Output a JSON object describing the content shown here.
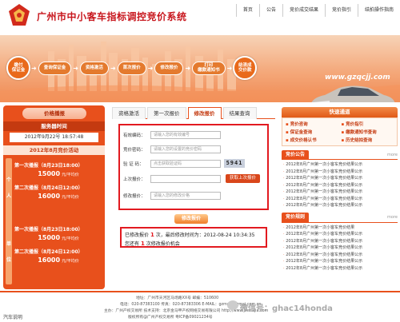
{
  "header": {
    "site_title": "广州市中小客车指标调控竞价系统",
    "nav": [
      "首页",
      "公告",
      "竞价成交结果",
      "竞价指引",
      "结拍操作指南"
    ]
  },
  "banner": {
    "website": "www.gzqcjj.com",
    "steps": [
      {
        "label": "缴付\n保证金",
        "shape": "circle"
      },
      {
        "label": "查询保证金",
        "shape": "pill"
      },
      {
        "label": "资格激活",
        "shape": "pill"
      },
      {
        "label": "首次报价",
        "shape": "pill"
      },
      {
        "label": "修改报价",
        "shape": "pill"
      },
      {
        "label": "打印\n缴款通知书",
        "shape": "pill"
      },
      {
        "label": "结清成\n交价款",
        "shape": "circle"
      }
    ]
  },
  "left": {
    "tab": "价格播报",
    "server_time_label": "服务器时间",
    "server_time": "2012年9月22号 18:57:48",
    "activity_title": "2012年8月竞价活动",
    "side_labels": [
      "个",
      "人",
      "单",
      "位"
    ],
    "rounds": [
      {
        "title": "第一次播报（8月23日18:00）",
        "price": "15000",
        "unit": "元/平均价"
      },
      {
        "title": "第二次播报（8月24日12:00）",
        "price": "16000",
        "unit": "元/平均价"
      },
      {
        "title": "第一次播报（8月23日18:00）",
        "price": "15000",
        "unit": "元/平均价"
      },
      {
        "title": "第二次播报（8月24日12:00）",
        "price": "16000",
        "unit": "元/平均价"
      }
    ]
  },
  "main": {
    "tabs": [
      "资格激活",
      "第一次报价",
      "修改报价",
      "结果查询"
    ],
    "active_tab": 2,
    "form": {
      "code_label": "有效编码：",
      "code_ph": "请输入您的有效编号",
      "pwd_label": "竞价密码：",
      "pwd_ph": "请输入您的设置的竞价密码",
      "captcha_label": "验 证 码：",
      "captcha_ph": "点击获取验证码",
      "captcha_value": "5941",
      "last_label": "上次报价：",
      "get_last": "获取上次报价",
      "modify_label": "修改报价：",
      "modify_ph": "请输入您的修改价格"
    },
    "submit": "修改报价",
    "result": {
      "line1_a": "已修改报价",
      "line1_b": "1",
      "line1_c": "次，最后修改时间为：2012-08-24 10:34:35",
      "line2_a": "您还有",
      "line2_b": "1",
      "line2_c": "次修改报价机会"
    }
  },
  "right": {
    "quick_title": "快速通道",
    "quick_links": [
      "竞价咨询",
      "竞价指引",
      "保证金查询",
      "缴款通知书查询",
      "成交价格认书",
      "历史结拍查询"
    ],
    "announce_title": "竞价公告",
    "announce_more": "more",
    "announce_items": [
      "2012年8月广州第一次小客车竞价结果公示",
      "2012年8月广州第一次小客车竞价结果公示",
      "2012年8月广州第一次小客车竞价结果公示",
      "2012年8月广州第一次小客车竞价结果公示",
      "2012年8月广州第一次小客车竞价结果公示",
      "2012年8月广州第一次小客车竞价结果公示",
      "2012年8月广州第一次小客车竞价结果公示"
    ],
    "rules_title": "竞价规则",
    "rules_more": "more",
    "rules_items": [
      "2012年8月广州第一次小客车竞价结果",
      "2012年8月广州第一次小客车竞价结果公示",
      "2012年8月广州第一次小客车竞价结果公示",
      "2012年8月广州第一次小客车竞价结果公示",
      "2012年8月广州第一次小客车竞价结果公示",
      "2012年8月广州第一次小客车竞价结果公示",
      "2012年8月广州第一次小客车竞价结果公示"
    ]
  },
  "footer": {
    "line1": "地址：广州市天河区马场路XX号 邮编：510600",
    "line2": "电话：020-87383100  传真：020-87383306  E-MAIL：gzmai@gzmai.com.cn",
    "line3": "主办：广州产权交易所  技术支持：北京金马甲产权网络交易有限公司 http://www.jinmajia.com",
    "line4": "版权所有@广州产权交易所  粤ICP备09021234号"
  },
  "watermarks": {
    "left": "汽车说明",
    "right": "微信号：ghac14honda"
  }
}
